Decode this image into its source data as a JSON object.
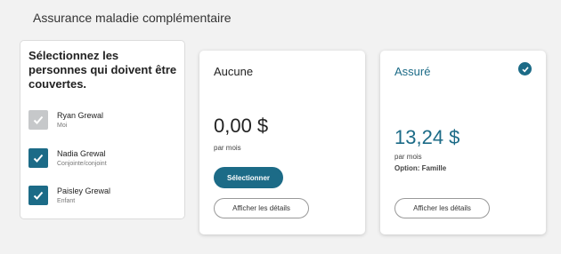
{
  "section": {
    "title": "Assurance maladie complémentaire"
  },
  "persons": {
    "heading": "Sélectionnez les personnes qui doivent être couvertes.",
    "items": [
      {
        "name": "Ryan Grewal",
        "relation": "Moi",
        "checked": true,
        "disabled": true
      },
      {
        "name": "Nadia Grewal",
        "relation": "Conjointe/conjoint",
        "checked": true,
        "disabled": false
      },
      {
        "name": "Paisley Grewal",
        "relation": "Enfant",
        "checked": true,
        "disabled": false
      }
    ]
  },
  "plans": {
    "none": {
      "title": "Aucune",
      "price": "0,00 $",
      "per_month": "par mois",
      "select_label": "Sélectionner",
      "details_label": "Afficher les détails"
    },
    "insured": {
      "title": "Assuré",
      "price": "13,24 $",
      "per_month": "par mois",
      "option": "Option: Famille",
      "details_label": "Afficher les détails",
      "selected": true
    }
  },
  "colors": {
    "accent": "#1c6b87",
    "disabled": "#c6c8ca"
  },
  "icons": {
    "checkbox": "check-icon",
    "selected": "check-circle-icon"
  }
}
